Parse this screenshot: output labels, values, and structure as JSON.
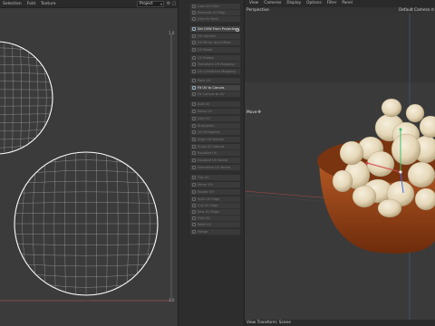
{
  "uv_editor": {
    "menu": [
      "Selection",
      "Fold",
      "Texture"
    ],
    "project_select": "Project",
    "corner_top": "1,0",
    "corner_bottom": "1,0"
  },
  "tool_palette": {
    "items": [
      {
        "label": "Load UV Grid",
        "active": false
      },
      {
        "label": "Relocate UV Map",
        "active": false
      },
      {
        "label": "Grid UV Rect",
        "active": false
      },
      {
        "label": "Set UVW From Projection",
        "active": true
      },
      {
        "label": "UV Optimal",
        "active": false
      },
      {
        "label": "UV Mirror and Offset",
        "active": false
      },
      {
        "label": "UV Reset",
        "active": false
      },
      {
        "label": "UV Rotate",
        "active": false
      },
      {
        "label": "Transform UV Mapping",
        "active": false
      },
      {
        "label": "UV Cylindrical Mapping",
        "active": false
      },
      {
        "label": "Pack UV",
        "active": false
      },
      {
        "label": "Fit UV to Canvas",
        "active": true
      },
      {
        "label": "Fit Canvas to UV",
        "active": false
      },
      {
        "label": "Add UV",
        "active": false
      },
      {
        "label": "Relax UV",
        "active": false
      },
      {
        "label": "Grid UV",
        "active": false
      },
      {
        "label": "Straighten",
        "active": false
      },
      {
        "label": "UV Straighten",
        "active": false
      },
      {
        "label": "Align UV Islands",
        "active": false
      },
      {
        "label": "Scale UV Islands",
        "active": false
      },
      {
        "label": "Equalize UV",
        "active": false
      },
      {
        "label": "Equalize UV Island",
        "active": false
      },
      {
        "label": "Normalize UV Island",
        "active": false
      },
      {
        "label": "Flip UV",
        "active": false
      },
      {
        "label": "Mirror UV",
        "active": false
      },
      {
        "label": "Rotate UV",
        "active": false
      },
      {
        "label": "Split UV Edge",
        "active": false
      },
      {
        "label": "Cut UV Edge",
        "active": false
      },
      {
        "label": "Sew UV Edge",
        "active": false
      },
      {
        "label": "Fold UV",
        "active": false
      },
      {
        "label": "Weld UV",
        "active": false
      },
      {
        "label": "Merge",
        "active": false
      }
    ]
  },
  "viewport": {
    "menu": [
      "View",
      "Cameras",
      "Display",
      "Options",
      "Filter",
      "Panel"
    ],
    "projection": "Perspective",
    "camera": "Default Camera ⊙",
    "tool_label": "Move",
    "footer": "View Transform: Scene"
  },
  "colors": {
    "bowl_outer": "#a6501e",
    "bowl_inner": "#7a3410",
    "egg": "#e8dcc0",
    "wire": "#ffffff",
    "axis_green": "#3fbf6a",
    "axis_red": "#d04848",
    "axis_blue": "#4a6be0"
  }
}
